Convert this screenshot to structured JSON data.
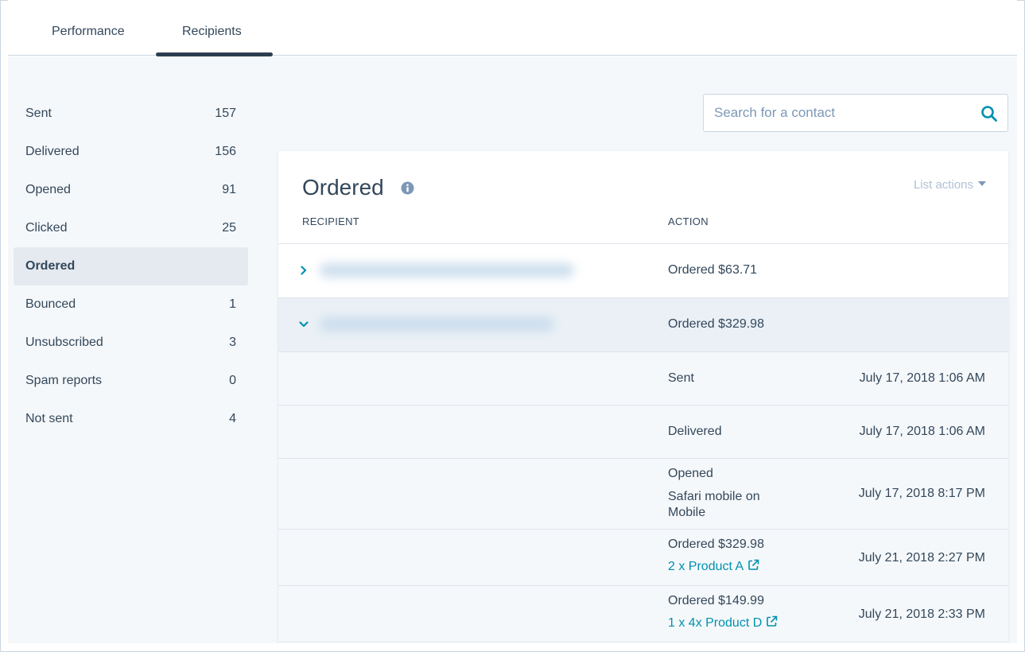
{
  "tabs": {
    "performance": "Performance",
    "recipients": "Recipients"
  },
  "sidebar": {
    "items": [
      {
        "label": "Sent",
        "count": "157"
      },
      {
        "label": "Delivered",
        "count": "156"
      },
      {
        "label": "Opened",
        "count": "91"
      },
      {
        "label": "Clicked",
        "count": "25"
      },
      {
        "label": "Ordered",
        "count": ""
      },
      {
        "label": "Bounced",
        "count": "1"
      },
      {
        "label": "Unsubscribed",
        "count": "3"
      },
      {
        "label": "Spam reports",
        "count": "0"
      },
      {
        "label": "Not sent",
        "count": "4"
      }
    ]
  },
  "search": {
    "placeholder": "Search for a contact"
  },
  "card": {
    "title": "Ordered",
    "list_actions": "List actions",
    "col_recipient": "RECIPIENT",
    "col_action": "ACTION"
  },
  "rows": [
    {
      "action": "Ordered $63.71"
    },
    {
      "action": "Ordered $329.98"
    }
  ],
  "events": [
    {
      "action": "Sent",
      "detail": "",
      "link": "",
      "time": "July 17, 2018 1:06 AM"
    },
    {
      "action": "Delivered",
      "detail": "",
      "link": "",
      "time": "July 17, 2018 1:06 AM"
    },
    {
      "action": "Opened",
      "detail": "Safari mobile on Mobile",
      "link": "",
      "time": "July 17, 2018 8:17 PM"
    },
    {
      "action": "Ordered $329.98",
      "detail": "",
      "link": "2 x Product A",
      "time": "July 21, 2018 2:27 PM"
    },
    {
      "action": "Ordered $149.99",
      "detail": "",
      "link": "1 x 4x Product D",
      "time": "July 21, 2018 2:33 PM"
    }
  ],
  "colors": {
    "accent": "#0091ae",
    "text": "#33475b",
    "tab_underline": "#2d3e50"
  },
  "icons": [
    "search-icon",
    "info-icon",
    "chevron-right-icon",
    "chevron-down-icon",
    "external-link-icon",
    "caret-down-icon"
  ]
}
